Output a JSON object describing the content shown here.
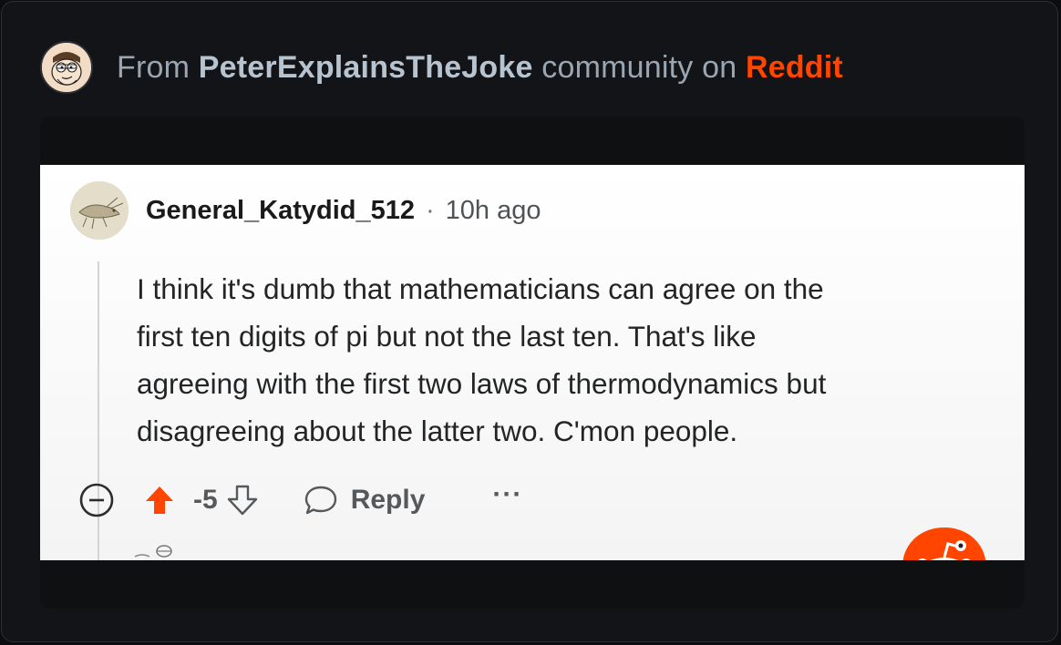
{
  "header": {
    "prefix": "From",
    "community": "PeterExplainsTheJoke",
    "middle": "community on",
    "brand": "Reddit",
    "avatar_icon": "peter-griffin-avatar-icon"
  },
  "comment": {
    "username": "General_Katydid_512",
    "separator": "·",
    "time": "10h ago",
    "lines": [
      "I think it's dumb that mathematicians can agree on the",
      "first ten digits of pi but not the last ten. That's like",
      "agreeing with the first two laws of thermodynamics but",
      "disagreeing about the latter two. C'mon people."
    ],
    "score": "-5",
    "reply_label": "Reply",
    "more_label": "···"
  },
  "colors": {
    "brand": "#ff4500",
    "upvote_active": "#ff4500",
    "card_bg": "#121417",
    "header_text": "#9aa6b1"
  },
  "icons": [
    "collapse-icon",
    "upvote-icon",
    "downvote-icon",
    "reply-bubble-icon",
    "more-options-icon",
    "reddit-snoo-icon",
    "katydid-avatar-icon"
  ]
}
